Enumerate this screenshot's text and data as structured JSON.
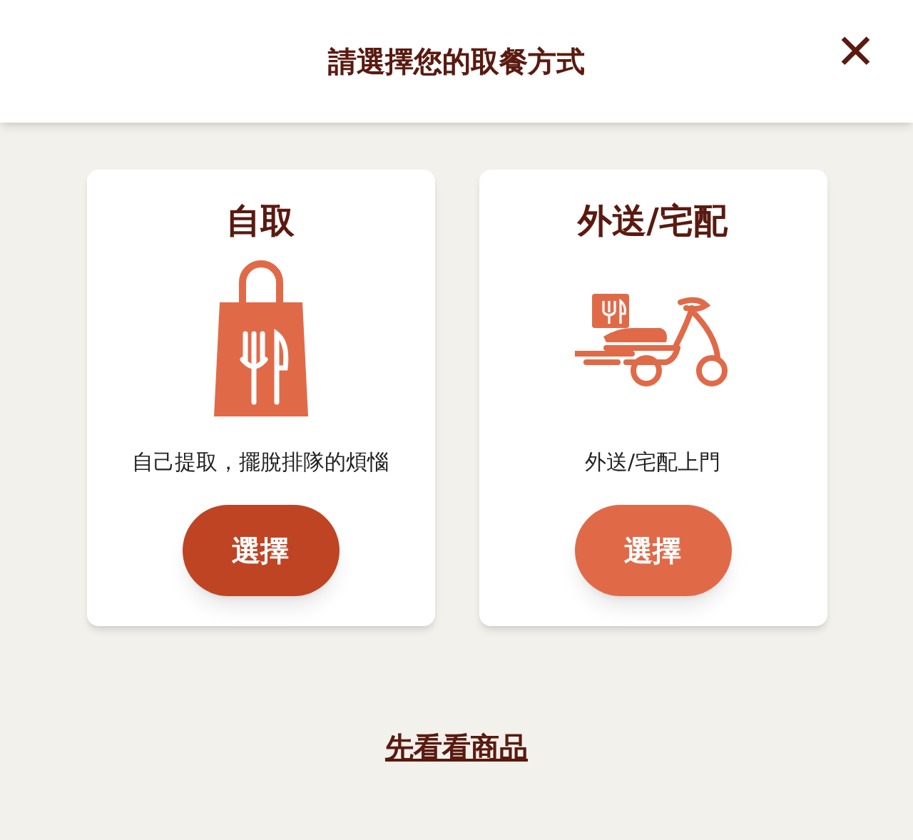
{
  "header": {
    "title": "請選擇您的取餐方式",
    "close": "✕"
  },
  "options": [
    {
      "kind": "pickup",
      "title": "自取",
      "description": "自己提取，擺脫排隊的煩惱",
      "button": "選擇",
      "selected": true
    },
    {
      "kind": "delivery",
      "title": "外送/宅配",
      "description": "外送/宅配上門",
      "button": "選擇",
      "selected": false
    }
  ],
  "browse_link": "先看看商品"
}
